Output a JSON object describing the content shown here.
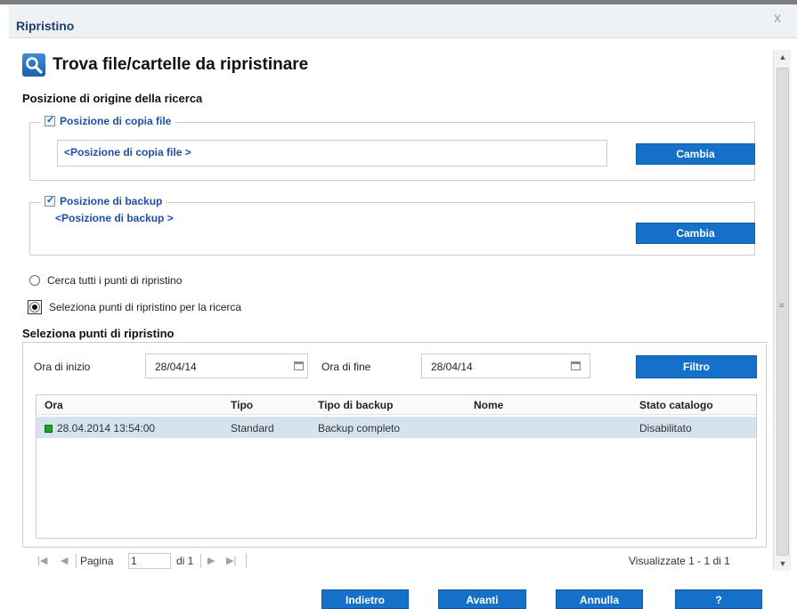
{
  "dialog": {
    "title": "Ripristino",
    "close_glyph": "x"
  },
  "header": {
    "icon": "search-icon",
    "title": "Trova file/cartelle da ripristinare"
  },
  "search_origin": {
    "heading": "Posizione di origine della ricerca",
    "file_copy": {
      "checked": true,
      "label": "Posizione di copia file",
      "path": "<Posizione di copia file >",
      "button": "Cambia"
    },
    "backup": {
      "checked": true,
      "label": "Posizione di backup",
      "path": "<Posizione di backup >",
      "button": "Cambia"
    }
  },
  "search_mode": {
    "option_all": "Cerca tutti i punti di ripristino",
    "option_select": "Seleziona punti di ripristino per la ricerca",
    "selected": "option_select"
  },
  "restore_points": {
    "heading": "Seleziona punti di ripristino",
    "start_label": "Ora di inizio",
    "start_value": "28/04/14",
    "end_label": "Ora di fine",
    "end_value": "28/04/14",
    "filter_button": "Filtro",
    "columns": [
      "Ora",
      "Tipo",
      "Tipo di backup",
      "Nome",
      "Stato catalogo"
    ],
    "rows": [
      {
        "time": "28.04.2014 13:54:00",
        "type": "Standard",
        "backup_type": "Backup completo",
        "name": "",
        "catalog_status": "Disabilitato",
        "status_color": "#1ea41e"
      }
    ]
  },
  "pager": {
    "page_label": "Pagina",
    "page_value": "1",
    "of_label": "di 1",
    "summary": "Visualizzate 1 - 1 di 1"
  },
  "footer": {
    "back": "Indietro",
    "next": "Avanti",
    "cancel": "Annulla",
    "help": "?"
  },
  "colors": {
    "accent": "#1470c8",
    "title_text": "#1d3f6e",
    "legend_text": "#1f4fa3",
    "selected_row": "#d5e3ef"
  }
}
